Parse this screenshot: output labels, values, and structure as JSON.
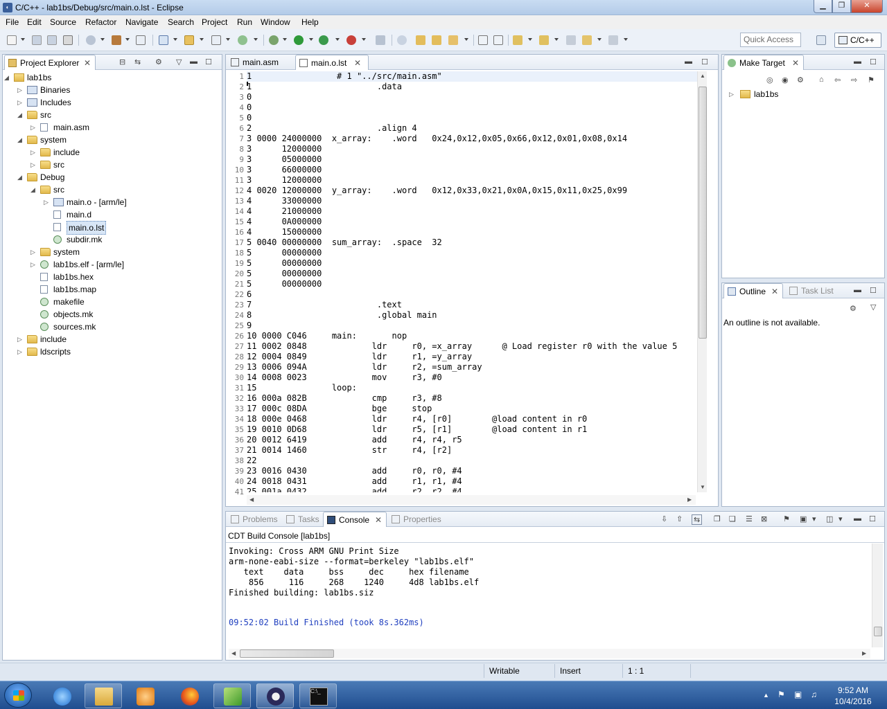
{
  "window": {
    "title": "C/C++ - lab1bs/Debug/src/main.o.lst - Eclipse"
  },
  "menu": [
    "File",
    "Edit",
    "Source",
    "Refactor",
    "Navigate",
    "Search",
    "Project",
    "Run",
    "Window",
    "Help"
  ],
  "toolbar": {
    "quick_access_placeholder": "Quick Access",
    "perspective": "C/C++"
  },
  "project_explorer": {
    "tab_label": "Project Explorer",
    "tree": [
      {
        "label": "lab1bs",
        "depth": 0,
        "icon": "project-icon",
        "exp": "open"
      },
      {
        "label": "Binaries",
        "depth": 1,
        "icon": "binaries-icon",
        "exp": "closed"
      },
      {
        "label": "Includes",
        "depth": 1,
        "icon": "includes-icon",
        "exp": "closed"
      },
      {
        "label": "src",
        "depth": 1,
        "icon": "source-folder-icon",
        "exp": "open"
      },
      {
        "label": "main.asm",
        "depth": 2,
        "icon": "asm-file-icon",
        "exp": "closed"
      },
      {
        "label": "system",
        "depth": 1,
        "icon": "source-folder-icon",
        "exp": "open"
      },
      {
        "label": "include",
        "depth": 2,
        "icon": "folder-icon",
        "exp": "closed"
      },
      {
        "label": "src",
        "depth": 2,
        "icon": "folder-icon",
        "exp": "closed"
      },
      {
        "label": "Debug",
        "depth": 1,
        "icon": "folder-icon",
        "exp": "open"
      },
      {
        "label": "src",
        "depth": 2,
        "icon": "folder-icon",
        "exp": "open"
      },
      {
        "label": "main.o - [arm/le]",
        "depth": 3,
        "icon": "object-file-icon",
        "exp": "closed"
      },
      {
        "label": "main.d",
        "depth": 3,
        "icon": "file-icon",
        "exp": "none"
      },
      {
        "label": "main.o.lst",
        "depth": 3,
        "icon": "file-icon",
        "exp": "none",
        "selected": true
      },
      {
        "label": "subdir.mk",
        "depth": 3,
        "icon": "makefile-icon",
        "exp": "none"
      },
      {
        "label": "system",
        "depth": 2,
        "icon": "folder-icon",
        "exp": "closed"
      },
      {
        "label": "lab1bs.elf - [arm/le]",
        "depth": 2,
        "icon": "elf-binary-icon",
        "exp": "closed"
      },
      {
        "label": "lab1bs.hex",
        "depth": 2,
        "icon": "file-icon",
        "exp": "none"
      },
      {
        "label": "lab1bs.map",
        "depth": 2,
        "icon": "file-icon",
        "exp": "none"
      },
      {
        "label": "makefile",
        "depth": 2,
        "icon": "makefile-icon",
        "exp": "none"
      },
      {
        "label": "objects.mk",
        "depth": 2,
        "icon": "makefile-icon",
        "exp": "none"
      },
      {
        "label": "sources.mk",
        "depth": 2,
        "icon": "makefile-icon",
        "exp": "none"
      },
      {
        "label": "include",
        "depth": 1,
        "icon": "folder-icon",
        "exp": "closed"
      },
      {
        "label": "ldscripts",
        "depth": 1,
        "icon": "folder-icon",
        "exp": "closed"
      }
    ]
  },
  "editor": {
    "tabs": [
      {
        "label": "main.asm",
        "active": false
      },
      {
        "label": "main.o.lst",
        "active": true
      }
    ],
    "lines": [
      "1                 # 1 \"../src/main.asm\"",
      "1                         .data",
      "0",
      "0",
      "0",
      "2                         .align 4",
      "3 0000 24000000  x_array:    .word   0x24,0x12,0x05,0x66,0x12,0x01,0x08,0x14",
      "3      12000000",
      "3      05000000",
      "3      66000000",
      "3      12000000",
      "4 0020 12000000  y_array:    .word   0x12,0x33,0x21,0x0A,0x15,0x11,0x25,0x99",
      "4      33000000",
      "4      21000000",
      "4      0A000000",
      "4      15000000",
      "5 0040 00000000  sum_array:  .space  32",
      "5      00000000",
      "5      00000000",
      "5      00000000",
      "5      00000000",
      "6",
      "7                         .text",
      "8                         .global main",
      "9",
      "10 0000 C046     main:       nop",
      "11 0002 0848             ldr     r0, =x_array      @ Load register r0 with the value 5",
      "12 0004 0849             ldr     r1, =y_array",
      "13 0006 094A             ldr     r2, =sum_array",
      "14 0008 0023             mov     r3, #0",
      "15               loop:",
      "16 000a 082B             cmp     r3, #8",
      "17 000c 08DA             bge     stop",
      "18 000e 0468             ldr     r4, [r0]        @load content in r0",
      "19 0010 0D68             ldr     r5, [r1]        @load content in r1",
      "20 0012 6419             add     r4, r4, r5",
      "21 0014 1460             str     r4, [r2]",
      "22",
      "23 0016 0430             add     r0, r0, #4",
      "24 0018 0431             add     r1, r1, #4",
      "25 001a 0432             add     r2, r2, #4"
    ]
  },
  "make_target": {
    "tab_label": "Make Target",
    "tree": [
      {
        "label": "lab1bs"
      }
    ]
  },
  "outline": {
    "tab_label": "Outline",
    "other_tab": "Task List",
    "message": "An outline is not available."
  },
  "bottom_panel": {
    "tabs": [
      "Problems",
      "Tasks",
      "Console",
      "Properties"
    ],
    "active_tab": "Console",
    "console_title": "CDT Build Console [lab1bs]",
    "console_lines": [
      "Invoking: Cross ARM GNU Print Size",
      "arm-none-eabi-size --format=berkeley \"lab1bs.elf\"",
      "   text    data     bss     dec     hex filename",
      "    856     116     268    1240     4d8 lab1bs.elf",
      "Finished building: lab1bs.siz",
      "",
      "",
      ""
    ],
    "build_finished": "09:52:02 Build Finished (took 8s.362ms)",
    "colors": {
      "build_finished": "#1f3fbf"
    }
  },
  "statusbar": {
    "writable": "Writable",
    "insert": "Insert",
    "position": "1 : 1"
  },
  "taskbar": {
    "apps": [
      "internet-explorer-icon",
      "file-explorer-icon",
      "media-player-icon",
      "firefox-icon",
      "app-icon",
      "eclipse-icon",
      "command-prompt-icon"
    ],
    "time": "9:52 AM",
    "date": "10/4/2016"
  }
}
